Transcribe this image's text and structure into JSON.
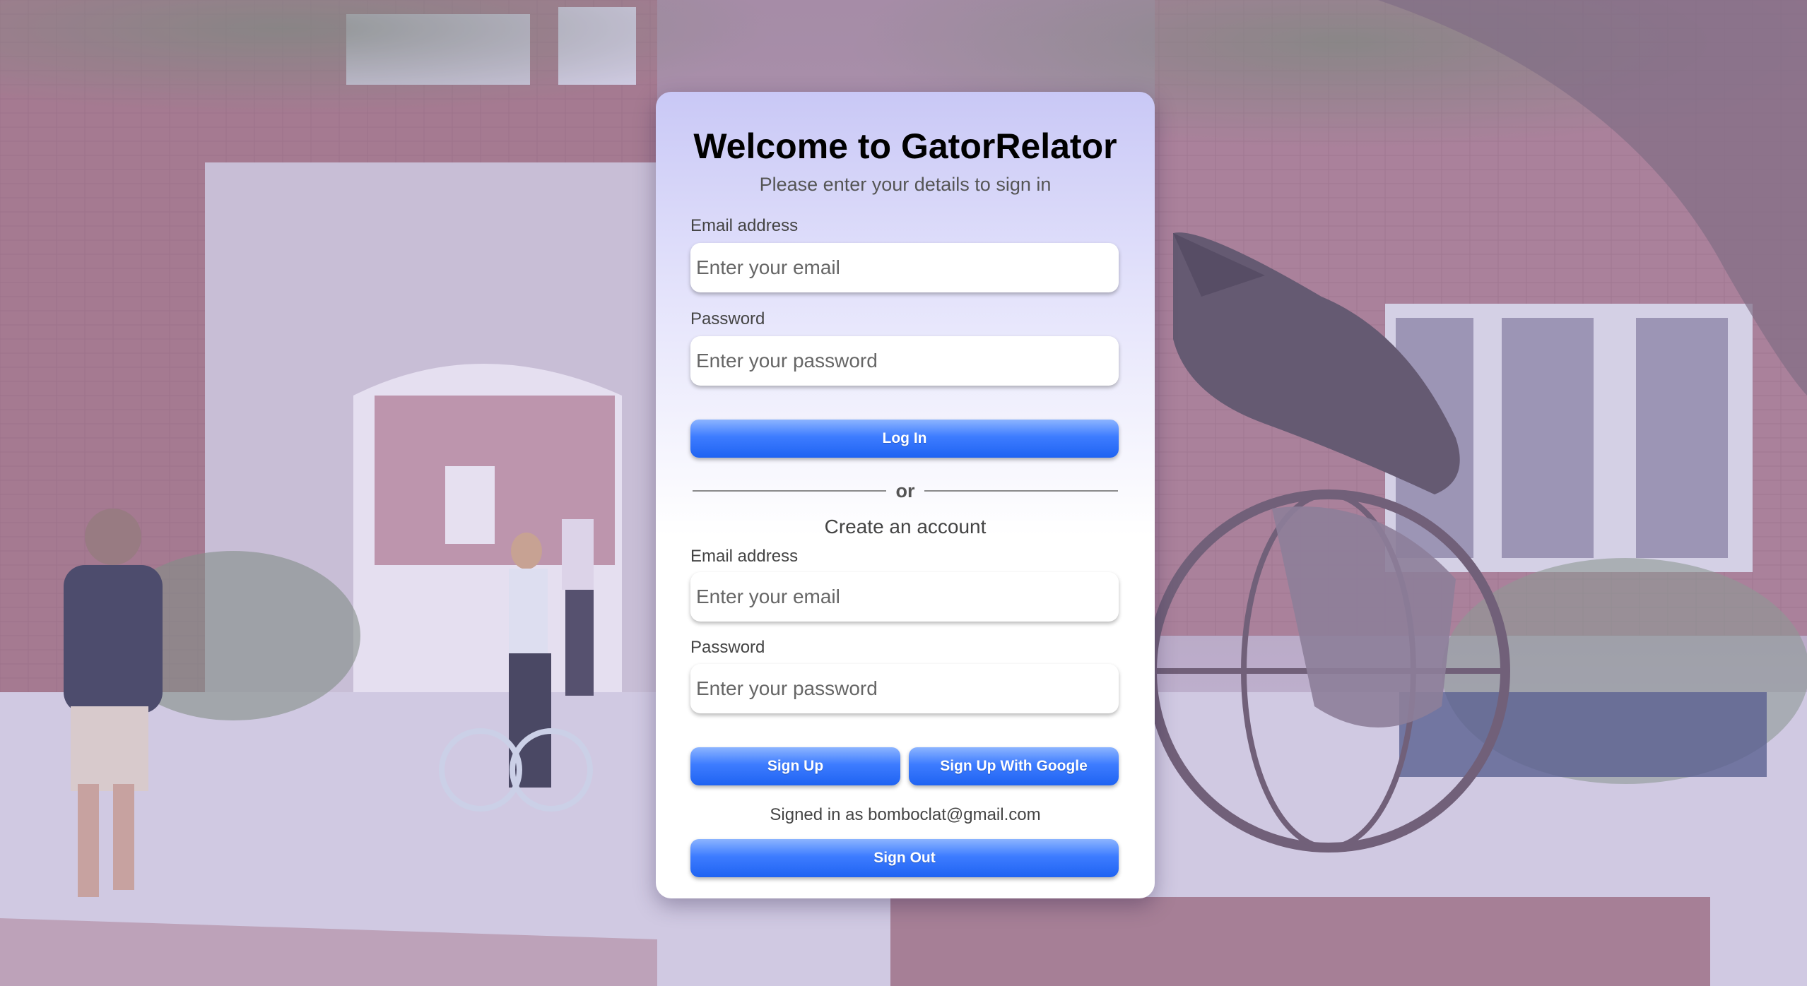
{
  "login": {
    "title": "Welcome to GatorRelator",
    "subtitle": "Please enter your details to sign in",
    "email_label": "Email address",
    "email_placeholder": "Enter your email",
    "password_label": "Password",
    "password_placeholder": "Enter your password",
    "login_button": "Log In"
  },
  "divider": {
    "text": "or"
  },
  "signup": {
    "title": "Create an account",
    "email_label": "Email address",
    "email_placeholder": "Enter your email",
    "password_label": "Password",
    "password_placeholder": "Enter your password",
    "signup_button": "Sign Up",
    "google_button": "Sign Up With Google"
  },
  "session": {
    "status": "Signed in as bomboclat@gmail.com",
    "signout_button": "Sign Out"
  },
  "colors": {
    "button": "#2f6ff7",
    "card_top": "#c9c8f6",
    "background_tint": "#a98ea6"
  },
  "background": {
    "description_icon": "campus-photo-with-gator-statue"
  }
}
